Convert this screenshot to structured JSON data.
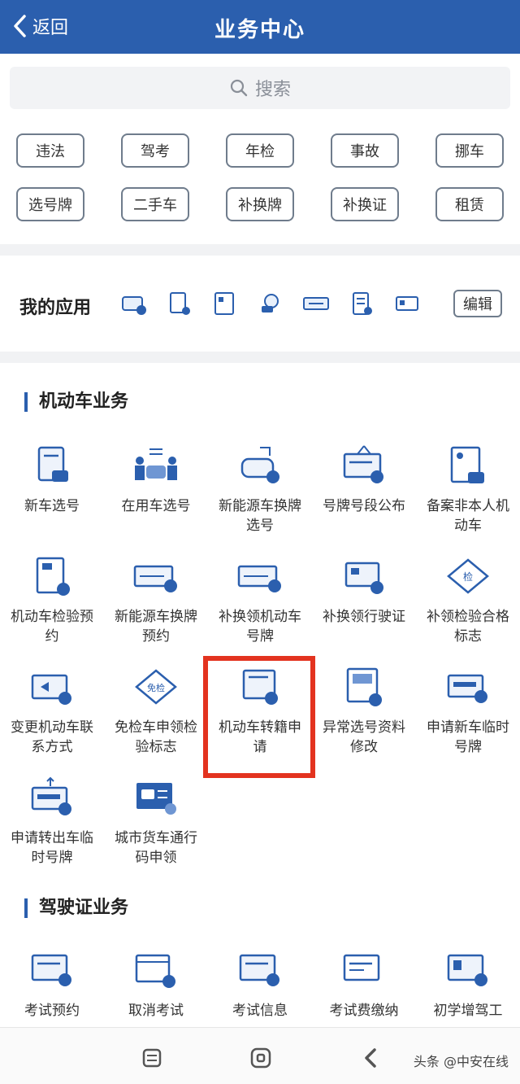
{
  "header": {
    "back_label": "返回",
    "title": "业务中心",
    "color": "#2b5fae"
  },
  "search": {
    "placeholder": "搜索"
  },
  "quick_tags": [
    "违法",
    "驾考",
    "年检",
    "事故",
    "挪车",
    "选号牌",
    "二手车",
    "补换牌",
    "补换证",
    "租赁"
  ],
  "my_apps": {
    "title": "我的应用",
    "edit_label": "编辑"
  },
  "sections": [
    {
      "title": "机动车业务",
      "items": [
        "新车选号",
        "在用车选号",
        "新能源车换牌选号",
        "号牌号段公布",
        "备案非本人机动车",
        "机动车检验预约",
        "新能源车换牌预约",
        "补换领机动车号牌",
        "补换领行驶证",
        "补领检验合格标志",
        "变更机动车联系方式",
        "免检车申领检验标志",
        "机动车转籍申请",
        "异常选号资料修改",
        "申请新车临时号牌",
        "申请转出车临时号牌",
        "城市货车通行码申领"
      ]
    },
    {
      "title": "驾驶证业务",
      "items": [
        "考试预约",
        "取消考试",
        "考试信息",
        "考试费缴纳",
        "初学增驾工"
      ]
    }
  ],
  "watermark": "头条 @中安在线"
}
